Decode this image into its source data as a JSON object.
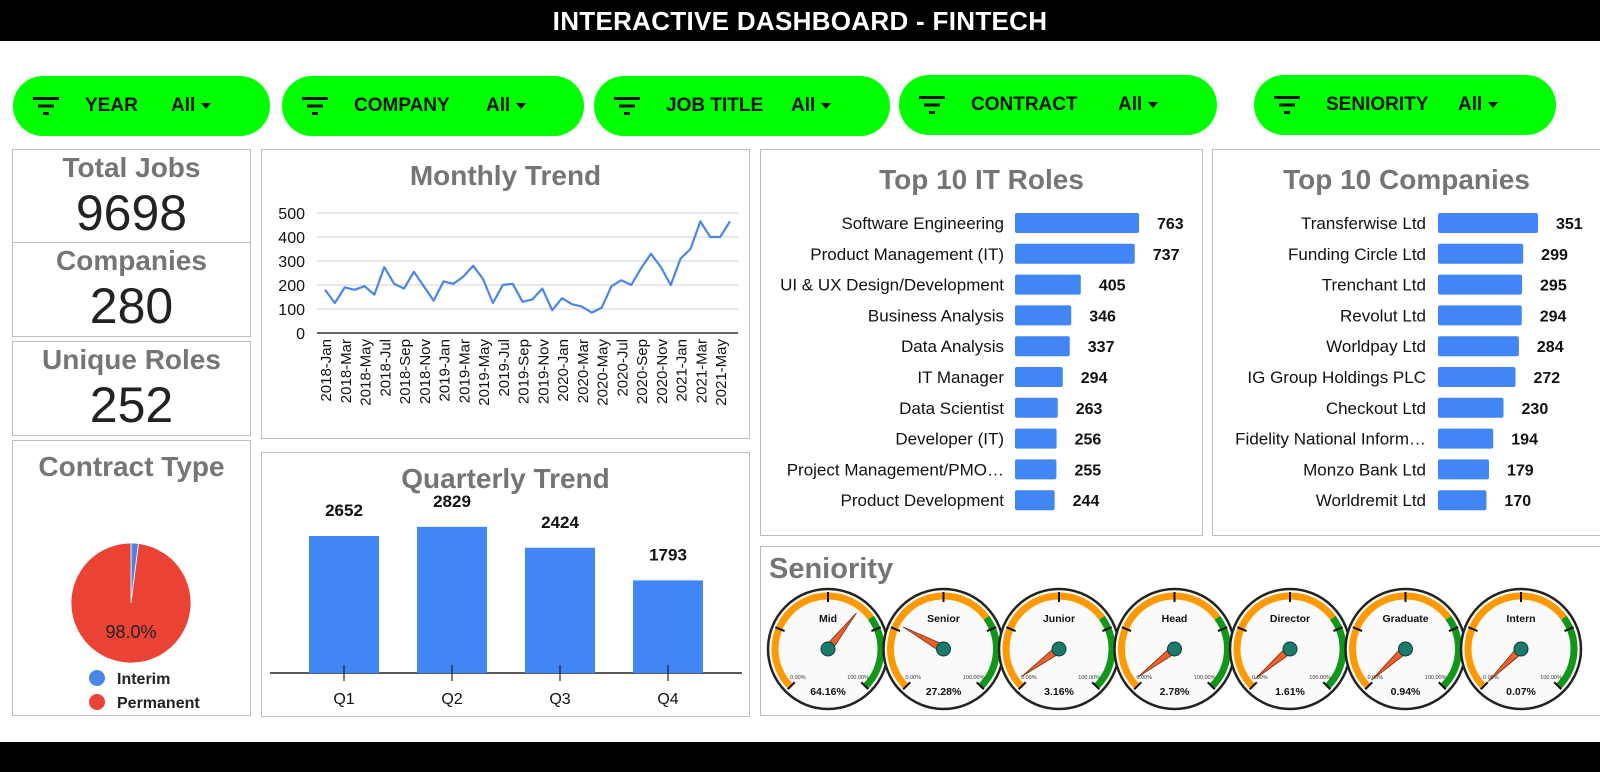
{
  "header": {
    "title": "INTERACTIVE DASHBOARD - FINTECH"
  },
  "filters": [
    {
      "label": "YEAR",
      "value": "All"
    },
    {
      "label": "COMPANY",
      "value": "All"
    },
    {
      "label": "JOB TITLE",
      "value": "All"
    },
    {
      "label": "CONTRACT",
      "value": "All"
    },
    {
      "label": "SENIORITY",
      "value": "All"
    }
  ],
  "kpis": {
    "total_jobs": {
      "label": "Total Jobs",
      "value": "9698"
    },
    "companies": {
      "label": "Companies",
      "value": "280"
    },
    "unique_roles": {
      "label": "Unique Roles",
      "value": "252"
    }
  },
  "colors": {
    "accent_green": "#00ff00",
    "bar_blue": "#4285f4",
    "permanent_red": "#ea4335",
    "interim_blue": "#4a86e8",
    "gauge_green": "#109618",
    "gauge_orange": "#ff9900"
  },
  "chart_data": [
    {
      "id": "contract_type",
      "type": "pie",
      "title": "Contract Type",
      "slices": [
        {
          "name": "Interim",
          "value": 2.0,
          "color": "#4a86e8"
        },
        {
          "name": "Permanent",
          "value": 98.0,
          "color": "#ea4335"
        }
      ],
      "data_label": "98.0%",
      "legend": "bottom"
    },
    {
      "id": "monthly_trend",
      "type": "line",
      "title": "Monthly Trend",
      "ylim": [
        0,
        500
      ],
      "yticks": [
        0,
        100,
        200,
        300,
        400,
        500
      ],
      "grid": true,
      "x": [
        "2018-Jan",
        "2018-Feb",
        "2018-Mar",
        "2018-Apr",
        "2018-May",
        "2018-Jun",
        "2018-Jul",
        "2018-Aug",
        "2018-Sep",
        "2018-Oct",
        "2018-Nov",
        "2018-Dec",
        "2019-Jan",
        "2019-Feb",
        "2019-Mar",
        "2019-Apr",
        "2019-May",
        "2019-Jun",
        "2019-Jul",
        "2019-Aug",
        "2019-Sep",
        "2019-Oct",
        "2019-Nov",
        "2019-Dec",
        "2020-Jan",
        "2020-Feb",
        "2020-Mar",
        "2020-Apr",
        "2020-May",
        "2020-Jun",
        "2020-Jul",
        "2020-Aug",
        "2020-Sep",
        "2020-Oct",
        "2020-Nov",
        "2020-Dec",
        "2021-Jan",
        "2021-Feb",
        "2021-Mar",
        "2021-Apr",
        "2021-May",
        "2021-Jun"
      ],
      "xtick_labels": [
        "2018-Jan",
        "2018-Mar",
        "2018-May",
        "2018-Jul",
        "2018-Sep",
        "2018-Nov",
        "2019-Jan",
        "2019-Mar",
        "2019-May",
        "2019-Jul",
        "2019-Sep",
        "2019-Nov",
        "2020-Jan",
        "2020-Mar",
        "2020-May",
        "2020-Jul",
        "2020-Sep",
        "2020-Nov",
        "2021-Jan",
        "2021-Mar",
        "2021-May"
      ],
      "series": [
        {
          "values": [
            180,
            125,
            190,
            180,
            195,
            160,
            275,
            205,
            185,
            255,
            195,
            135,
            215,
            205,
            235,
            280,
            225,
            125,
            200,
            205,
            130,
            140,
            185,
            95,
            145,
            120,
            110,
            85,
            105,
            195,
            220,
            200,
            270,
            330,
            275,
            200,
            310,
            350,
            465,
            400,
            400,
            465
          ],
          "color": "#4a86e8"
        }
      ]
    },
    {
      "id": "quarterly_trend",
      "type": "bar",
      "title": "Quarterly Trend",
      "categories": [
        "Q1",
        "Q2",
        "Q3",
        "Q4"
      ],
      "values": [
        2652,
        2829,
        2424,
        1793
      ],
      "ylim": [
        0,
        3000
      ],
      "color": "#4285f4"
    },
    {
      "id": "top_roles",
      "type": "bar",
      "orientation": "horizontal",
      "title": "Top 10 IT Roles",
      "categories": [
        "Software Engineering",
        "Product Management (IT)",
        "UI & UX Design/Development",
        "Business Analysis",
        "Data Analysis",
        "IT Manager",
        "Data Scientist",
        "Developer (IT)",
        "Project Management/PMO…",
        "Product Development"
      ],
      "values": [
        763,
        737,
        405,
        346,
        337,
        294,
        263,
        256,
        255,
        244
      ],
      "xlim": [
        0,
        763
      ],
      "color": "#4285f4"
    },
    {
      "id": "top_companies",
      "type": "bar",
      "orientation": "horizontal",
      "title": "Top 10 Companies",
      "categories": [
        "Transferwise Ltd",
        "Funding Circle Ltd",
        "Trenchant Ltd",
        "Revolut Ltd",
        "Worldpay Ltd",
        "IG Group Holdings PLC",
        "Checkout Ltd",
        "Fidelity National Inform…",
        "Monzo Bank Ltd",
        "Worldremit Ltd"
      ],
      "values": [
        351,
        299,
        295,
        294,
        284,
        272,
        230,
        194,
        179,
        170
      ],
      "xlim": [
        0,
        351
      ],
      "color": "#4285f4"
    },
    {
      "id": "seniority",
      "type": "gauge",
      "title": "Seniority",
      "range_labels": [
        "0.00%",
        "100.00%"
      ],
      "gauges": [
        {
          "name": "Mid",
          "value": 64.16,
          "label": "64.16%"
        },
        {
          "name": "Senior",
          "value": 27.28,
          "label": "27.28%"
        },
        {
          "name": "Junior",
          "value": 3.16,
          "label": "3.16%"
        },
        {
          "name": "Head",
          "value": 2.78,
          "label": "2.78%"
        },
        {
          "name": "Director",
          "value": 1.61,
          "label": "1.61%"
        },
        {
          "name": "Graduate",
          "value": 0.94,
          "label": "0.94%"
        },
        {
          "name": "Intern",
          "value": 0.07,
          "label": "0.07%"
        }
      ]
    }
  ]
}
